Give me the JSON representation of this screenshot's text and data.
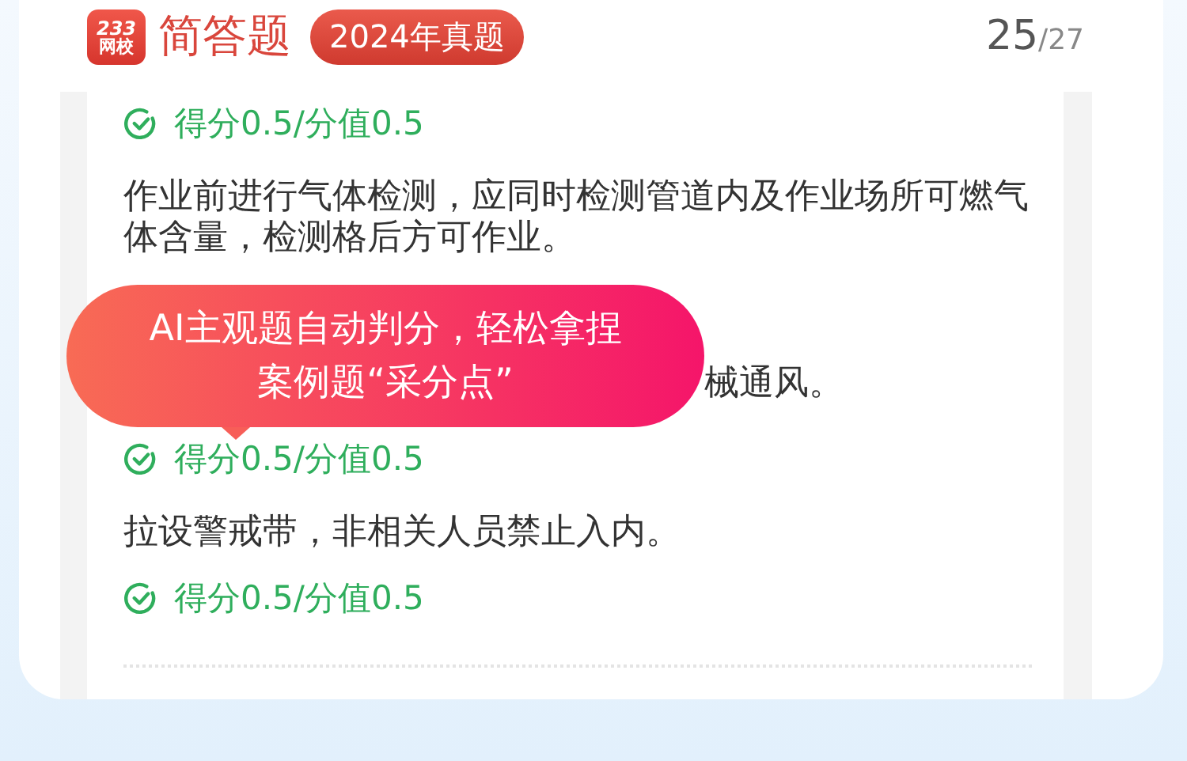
{
  "header": {
    "title": "简答题",
    "badge": "2024年真题",
    "progress": {
      "current": "25",
      "total": "/27"
    }
  },
  "logo": {
    "line_1": "233",
    "line_2": "网校"
  },
  "items": [
    {
      "kind": "score",
      "text": "得分0.5/分值0.5"
    },
    {
      "kind": "text",
      "text": "作业前进行气体检测，应同时检测管道内及作业场所可燃气体含量，检测格后方可作业。"
    },
    {
      "kind": "covered",
      "text": "械通风。"
    },
    {
      "kind": "score",
      "text": "得分0.5/分值0.5"
    },
    {
      "kind": "text",
      "text": "拉设警戒带，非相关人员禁止入内。"
    },
    {
      "kind": "score",
      "text": "得分0.5/分值0.5"
    }
  ],
  "tooltip": {
    "lines": [
      "AI主观题自动判分，轻松拿捏",
      "案例题“采分点”"
    ]
  }
}
